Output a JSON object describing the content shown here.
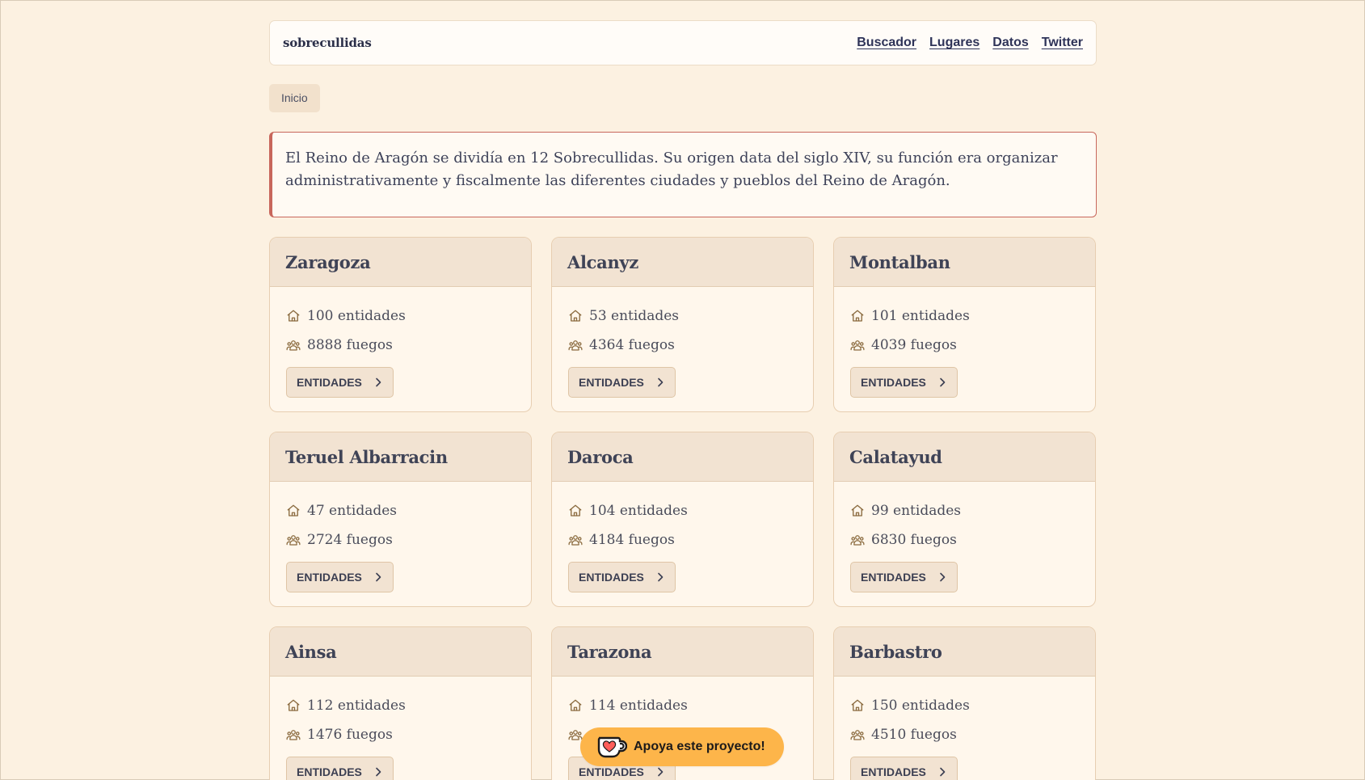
{
  "header": {
    "logo": "sobrecullidas",
    "nav": [
      "Buscador",
      "Lugares",
      "Datos",
      "Twitter"
    ]
  },
  "breadcrumb": {
    "home": "Inicio"
  },
  "intro": {
    "text": "El Reino de Aragón se dividía en 12 Sobrecullidas. Su origen data del siglo XIV, su función era organizar administrativamente y fiscalmente las diferentes ciudades y pueblos del Reino de Aragón."
  },
  "cards": [
    {
      "title": "Zaragoza",
      "entities": "100 entidades",
      "fires": "8888 fuegos",
      "button": "ENTIDADES"
    },
    {
      "title": "Alcanyz",
      "entities": "53 entidades",
      "fires": "4364 fuegos",
      "button": "ENTIDADES"
    },
    {
      "title": "Montalban",
      "entities": "101 entidades",
      "fires": "4039 fuegos",
      "button": "ENTIDADES"
    },
    {
      "title": "Teruel Albarracin",
      "entities": "47 entidades",
      "fires": "2724 fuegos",
      "button": "ENTIDADES"
    },
    {
      "title": "Daroca",
      "entities": "104 entidades",
      "fires": "4184 fuegos",
      "button": "ENTIDADES"
    },
    {
      "title": "Calatayud",
      "entities": "99 entidades",
      "fires": "6830 fuegos",
      "button": "ENTIDADES"
    },
    {
      "title": "Ainsa",
      "entities": "112 entidades",
      "fires": "1476 fuegos",
      "button": "ENTIDADES"
    },
    {
      "title": "Tarazona",
      "entities": "114 entidades",
      "fires": "",
      "button": "ENTIDADES"
    },
    {
      "title": "Barbastro",
      "entities": "150 entidades",
      "fires": "4510 fuegos",
      "button": "ENTIDADES"
    }
  ],
  "support": {
    "label": "Apoya este proyecto!",
    "icon": "ko-fi-cup-icon"
  },
  "colors": {
    "background": "#fcf1e1",
    "accent_border": "#c8675c",
    "support_button": "#fdb54a",
    "icon": "#8a6a3e"
  }
}
